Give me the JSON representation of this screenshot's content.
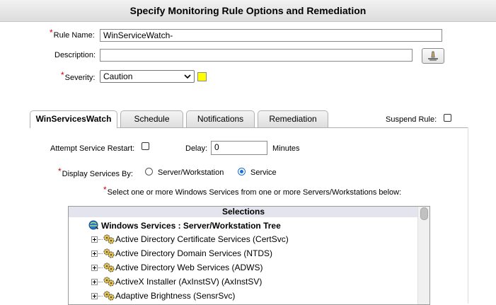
{
  "header": {
    "title": "Specify Monitoring Rule Options and Remediation"
  },
  "form": {
    "required_mark": "*",
    "rule_name_label": "Rule Name:",
    "rule_name_value": "WinServiceWatch-",
    "description_label": "Description:",
    "description_value": "",
    "severity_label": "Severity:",
    "severity_value": "Caution",
    "severity_color": "#ffff00"
  },
  "tabs": [
    {
      "label": "WinServicesWatch",
      "active": true
    },
    {
      "label": "Schedule",
      "active": false
    },
    {
      "label": "Notifications",
      "active": false
    },
    {
      "label": "Remediation",
      "active": false
    }
  ],
  "suspend": {
    "label": "Suspend Rule:",
    "checked": false
  },
  "options": {
    "restart_label": "Attempt Service Restart:",
    "restart_checked": false,
    "delay_label": "Delay:",
    "delay_value": "0",
    "delay_unit": "Minutes",
    "display_label": "Display Services By:",
    "display_options": [
      "Server/Workstation",
      "Service"
    ],
    "display_selected": "Service",
    "instruction": "Select one or more Windows Services from one or more Servers/Workstations below:"
  },
  "tree": {
    "header": "Selections",
    "root_label": "Windows Services : Server/Workstation Tree",
    "items": [
      "Active Directory Certificate Services (CertSvc)",
      "Active Directory Domain Services (NTDS)",
      "Active Directory Web Services (ADWS)",
      "ActiveX Installer (AxInstSV) (AxInstSV)",
      "Adaptive Brightness (SensrSvc)"
    ]
  }
}
